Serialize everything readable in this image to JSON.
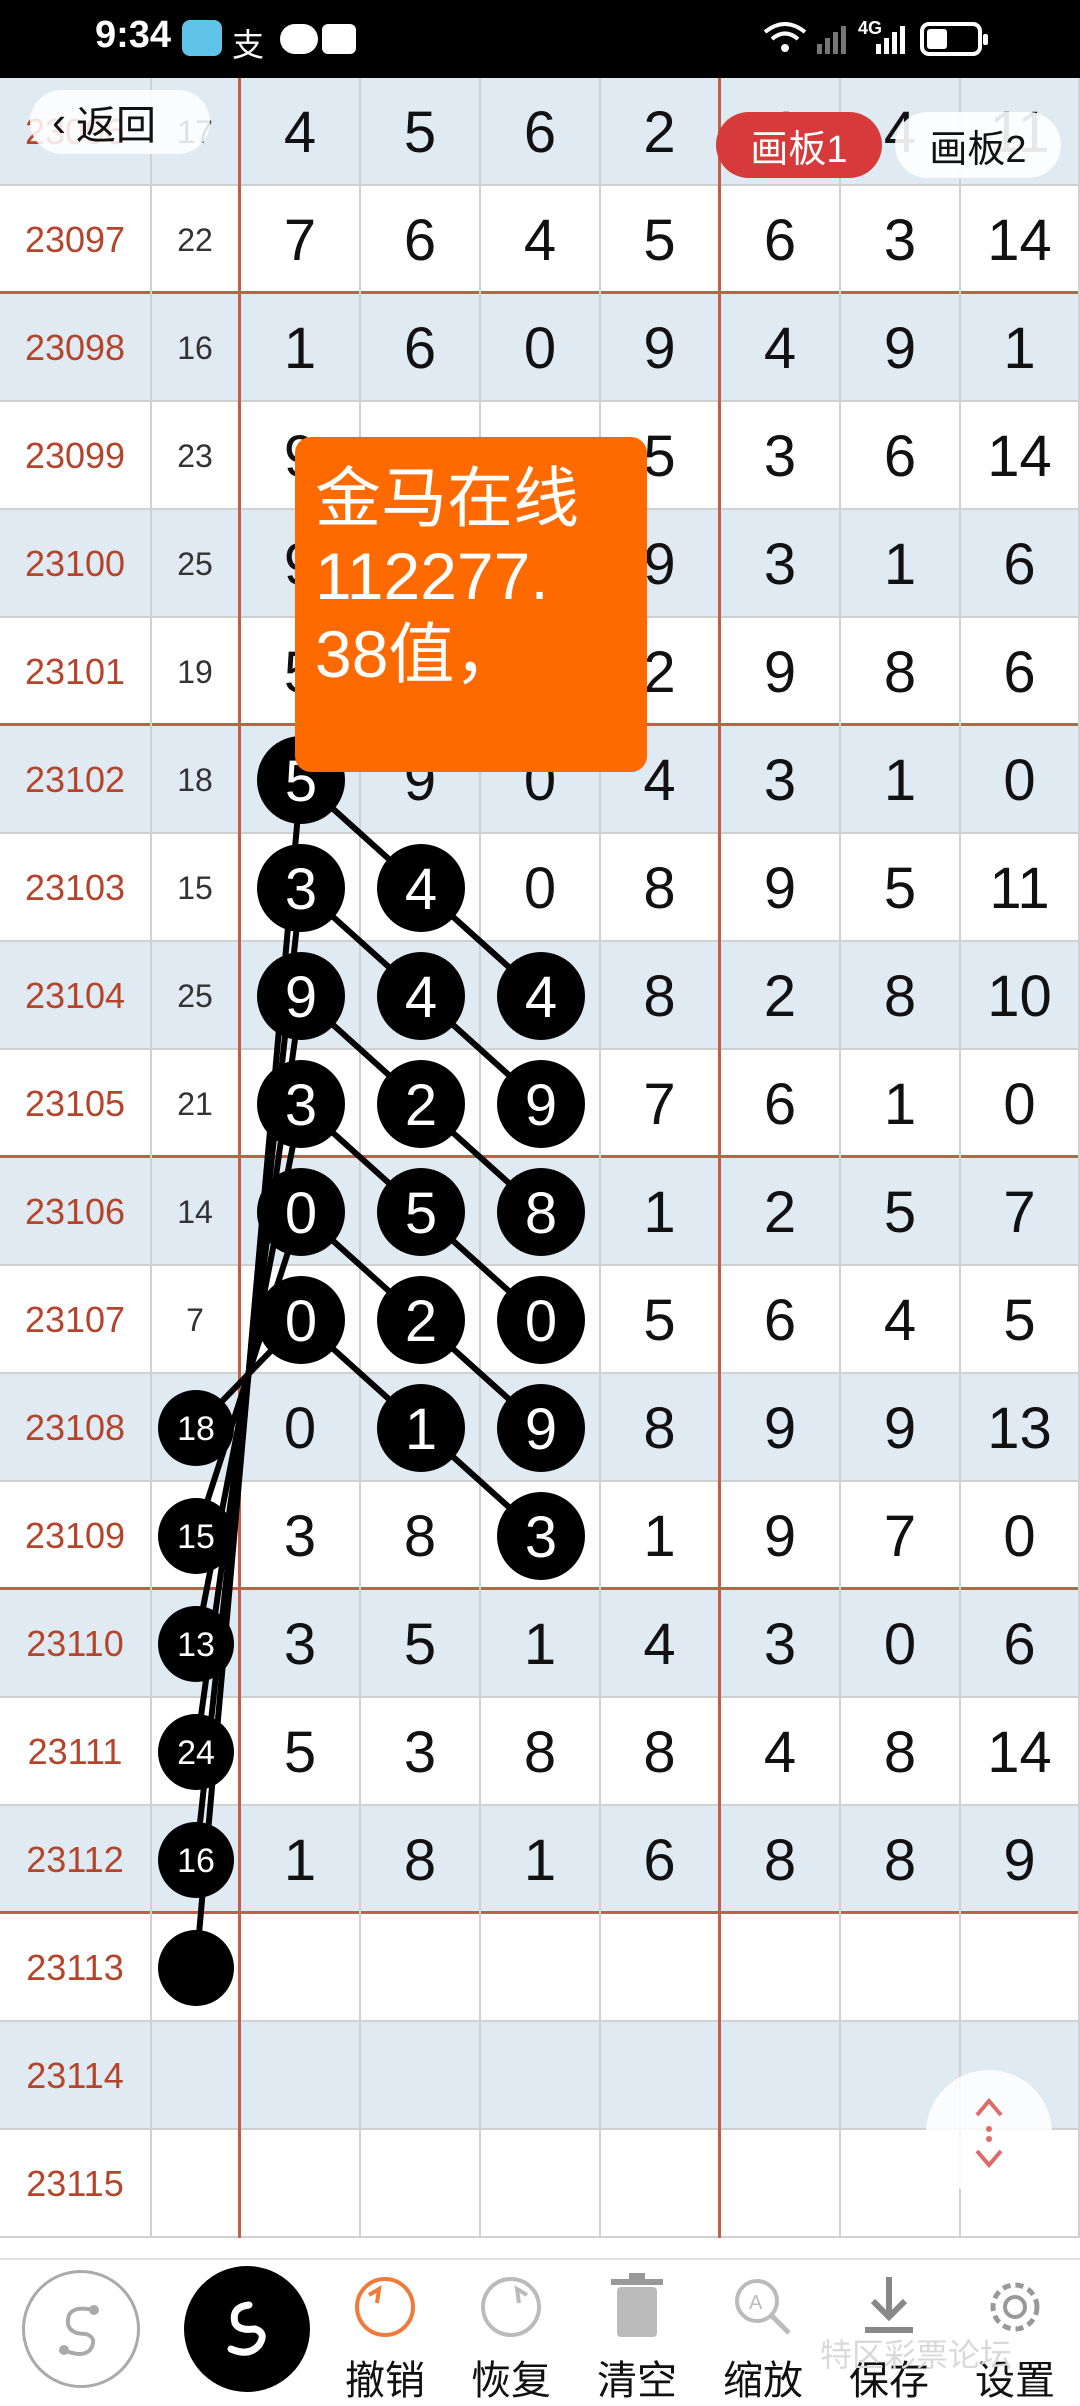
{
  "status_bar": {
    "time": "9:34",
    "network": "4G",
    "icons": [
      "app-icon",
      "alipay-icon",
      "message-icon",
      "huawei-icon",
      "wifi-icon",
      "signal-icon",
      "battery-icon"
    ]
  },
  "nav": {
    "back_label": "返回"
  },
  "tabs": [
    {
      "label": "画板1",
      "active": true
    },
    {
      "label": "画板2",
      "active": false
    }
  ],
  "note": {
    "lines": [
      "金马在线",
      "112277.",
      "38值，"
    ]
  },
  "table": {
    "rows": [
      {
        "period": "23096",
        "sum": "17",
        "digits": [
          "4",
          "5",
          "6",
          "2",
          "4",
          "4",
          "11"
        ]
      },
      {
        "period": "23097",
        "sum": "22",
        "digits": [
          "7",
          "6",
          "4",
          "5",
          "6",
          "3",
          "14"
        ]
      },
      {
        "period": "23098",
        "sum": "16",
        "digits": [
          "1",
          "6",
          "0",
          "9",
          "4",
          "9",
          "1"
        ]
      },
      {
        "period": "23099",
        "sum": "23",
        "digits": [
          "9",
          "",
          "",
          "5",
          "3",
          "6",
          "14"
        ]
      },
      {
        "period": "23100",
        "sum": "25",
        "digits": [
          "9",
          "",
          "",
          "9",
          "3",
          "1",
          "6"
        ]
      },
      {
        "period": "23101",
        "sum": "19",
        "digits": [
          "5",
          "",
          "",
          "2",
          "9",
          "8",
          "6"
        ]
      },
      {
        "period": "23102",
        "sum": "18",
        "digits": [
          "5",
          "9",
          "0",
          "4",
          "3",
          "1",
          "0"
        ]
      },
      {
        "period": "23103",
        "sum": "15",
        "digits": [
          "3",
          "4",
          "0",
          "8",
          "9",
          "5",
          "11"
        ]
      },
      {
        "period": "23104",
        "sum": "25",
        "digits": [
          "9",
          "4",
          "4",
          "8",
          "2",
          "8",
          "10"
        ]
      },
      {
        "period": "23105",
        "sum": "21",
        "digits": [
          "3",
          "2",
          "9",
          "7",
          "6",
          "1",
          "0"
        ]
      },
      {
        "period": "23106",
        "sum": "14",
        "digits": [
          "0",
          "5",
          "8",
          "1",
          "2",
          "5",
          "7"
        ]
      },
      {
        "period": "23107",
        "sum": "7",
        "digits": [
          "0",
          "2",
          "0",
          "5",
          "6",
          "4",
          "5"
        ]
      },
      {
        "period": "23108",
        "sum": "18",
        "digits": [
          "0",
          "1",
          "9",
          "8",
          "9",
          "9",
          "13"
        ]
      },
      {
        "period": "23109",
        "sum": "15",
        "digits": [
          "3",
          "8",
          "3",
          "1",
          "9",
          "7",
          "0"
        ]
      },
      {
        "period": "23110",
        "sum": "13",
        "digits": [
          "3",
          "5",
          "1",
          "4",
          "3",
          "0",
          "6"
        ]
      },
      {
        "period": "23111",
        "sum": "24",
        "digits": [
          "5",
          "3",
          "8",
          "8",
          "4",
          "8",
          "14"
        ]
      },
      {
        "period": "23112",
        "sum": "16",
        "digits": [
          "1",
          "8",
          "1",
          "6",
          "8",
          "8",
          "9"
        ]
      },
      {
        "period": "23113",
        "sum": "",
        "digits": [
          "",
          "",
          "",
          "",
          "",
          "",
          ""
        ]
      },
      {
        "period": "23114",
        "sum": "",
        "digits": [
          "",
          "",
          "",
          "",
          "",
          "",
          ""
        ]
      },
      {
        "period": "23115",
        "sum": "",
        "digits": [
          "",
          "",
          "",
          "",
          "",
          "",
          ""
        ]
      }
    ]
  },
  "toolbar": {
    "items": [
      {
        "label": "撤销",
        "icon": "undo-icon"
      },
      {
        "label": "恢复",
        "icon": "redo-icon"
      },
      {
        "label": "清空",
        "icon": "trash-icon"
      },
      {
        "label": "缩放",
        "icon": "zoom-icon"
      },
      {
        "label": "保存",
        "icon": "download-icon"
      },
      {
        "label": "设置",
        "icon": "gear-icon"
      }
    ]
  },
  "watermark": "特区彩票论坛",
  "colors": {
    "period_text": "#b5452a",
    "group_border": "#c0604a",
    "row_alt": "#dfeaf2",
    "tab_active": "#d73a3a",
    "note_bg": "#ff6a00",
    "marker": "#000000"
  }
}
